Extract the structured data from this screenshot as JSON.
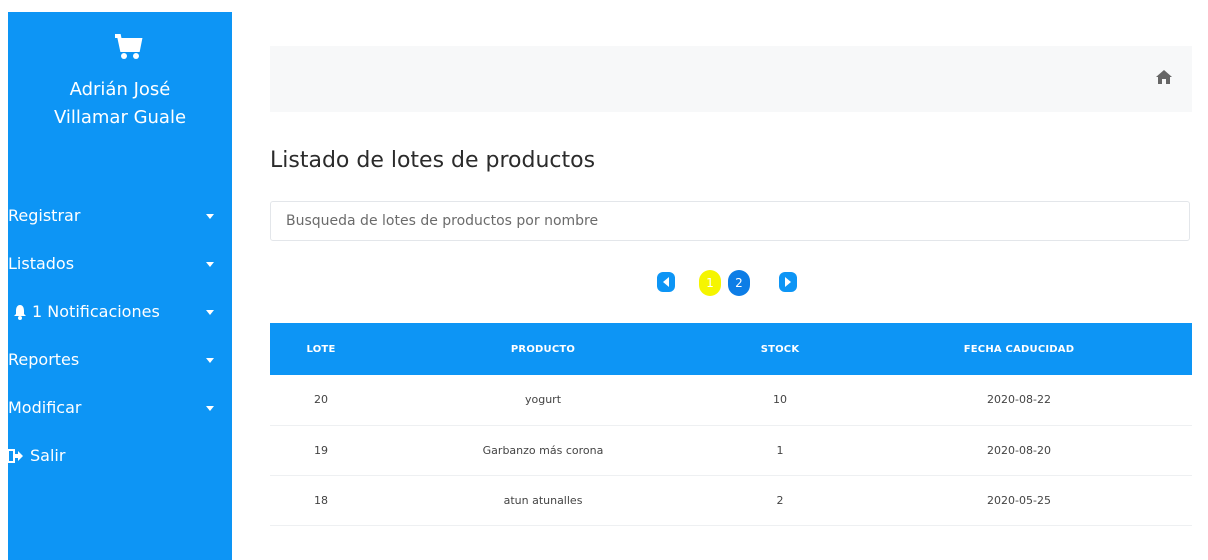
{
  "user": {
    "first_line": "Adrián José",
    "second_line": "Villamar Guale"
  },
  "sidebar": {
    "items": [
      {
        "label": "Registrar"
      },
      {
        "label": "Listados"
      },
      {
        "label": "Notificaciones",
        "badge": "1"
      },
      {
        "label": "Reportes"
      },
      {
        "label": "Modificar"
      },
      {
        "label": "Salir"
      }
    ]
  },
  "main": {
    "title": "Listado de lotes de productos",
    "search_placeholder": "Busqueda de lotes de productos por nombre",
    "pagination": {
      "pages": [
        "1",
        "2"
      ],
      "current": "1"
    },
    "table": {
      "headers": [
        "LOTE",
        "PRODUCTO",
        "STOCK",
        "FECHA CADUCIDAD"
      ],
      "rows": [
        [
          "20",
          "yogurt",
          "10",
          "2020-08-22"
        ],
        [
          "19",
          "Garbanzo más corona",
          "1",
          "2020-08-20"
        ],
        [
          "18",
          "atun atunalles",
          "2",
          "2020-05-25"
        ]
      ]
    }
  },
  "colors": {
    "accent": "#0d95f5",
    "active_page": "#f5f500",
    "topbar": "#f7f8f9"
  },
  "icons": {
    "logo": "shopping-cart-icon",
    "home": "home-icon",
    "notifications": "bell-icon",
    "logout": "sign-out-icon"
  }
}
